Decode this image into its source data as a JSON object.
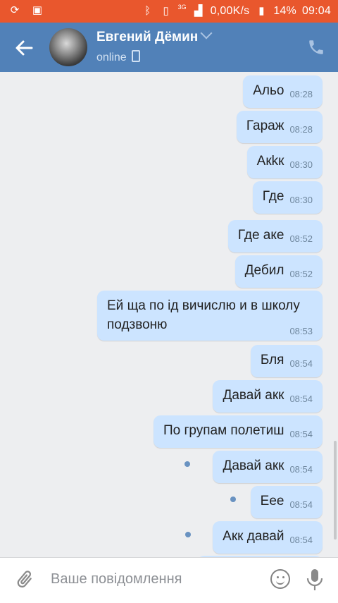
{
  "status_bar": {
    "left_icons": [
      "sync-icon",
      "image-icon"
    ],
    "right_icons": [
      "bluetooth-icon",
      "vibrate-icon",
      "signal-icon"
    ],
    "network_label": "3G",
    "speed": "0,00K/s",
    "battery": "14%",
    "time": "09:04"
  },
  "header": {
    "name": "Евгений Дёмин",
    "status": "online",
    "back_icon": "arrow-left-icon",
    "call_icon": "phone-icon"
  },
  "messages": [
    {
      "text": "Альо",
      "time": "08:28",
      "unread": false
    },
    {
      "text": "Гараж",
      "time": "08:28",
      "unread": false
    },
    {
      "text": "Акkк",
      "time": "08:30",
      "unread": false
    },
    {
      "text": "Где",
      "time": "08:30",
      "unread": false
    },
    {
      "text": "Где аке",
      "time": "08:52",
      "unread": false
    },
    {
      "text": "Дебил",
      "time": "08:52",
      "unread": false
    },
    {
      "text": "Ей ща по ід вичислю и в школу подзвоню",
      "time": "08:53",
      "unread": false
    },
    {
      "text": "Бля",
      "time": "08:54",
      "unread": false
    },
    {
      "text": "Давай акк",
      "time": "08:54",
      "unread": false
    },
    {
      "text": "По групам полетиш",
      "time": "08:54",
      "unread": false
    },
    {
      "text": "Давай акк",
      "time": "08:54",
      "unread": true
    },
    {
      "text": "Еее",
      "time": "08:54",
      "unread": true
    },
    {
      "text": "Акк давай",
      "time": "08:54",
      "unread": true
    }
  ],
  "input": {
    "placeholder": "Ваше повідомлення",
    "attach_icon": "paperclip-icon",
    "emoji_icon": "smile-icon",
    "mic_icon": "microphone-icon"
  },
  "colors": {
    "status_bar": "#e9572d",
    "header": "#5181b8",
    "bubble_out": "#cce4ff",
    "background": "#edeef0"
  }
}
